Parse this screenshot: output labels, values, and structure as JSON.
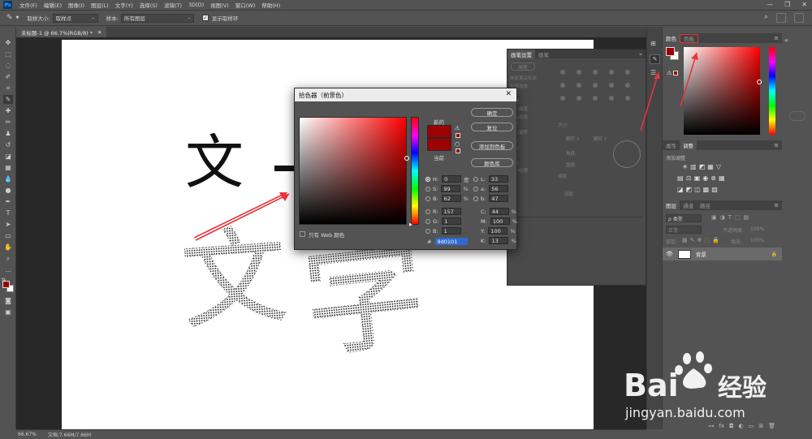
{
  "menubar": {
    "items": [
      "文件(F)",
      "编辑(E)",
      "图像(I)",
      "图层(L)",
      "文字(Y)",
      "选择(S)",
      "滤镜(T)",
      "3D(D)",
      "视图(V)",
      "窗口(W)",
      "帮助(H)"
    ],
    "app_logo": "Ps"
  },
  "options": {
    "sample_size_label": "取样大小:",
    "sample_size_value": "取样点",
    "sample_label": "样本:",
    "sample_value": "所有图层",
    "show_ring_label": "显示取样环"
  },
  "document": {
    "tab_title": "未标题-1 @ 66.7%(RGB/8) *",
    "zoom": "66.67%",
    "doc_info": "文档:7.66M/7.66M"
  },
  "color_picker": {
    "title": "拾色器（前景色）",
    "new_label": "新的",
    "current_label": "当前",
    "ok": "确定",
    "reset": "复位",
    "add_swatch": "添加到色板",
    "color_library": "颜色库",
    "web_only": "只有 Web 颜色",
    "hex_prefix": "#",
    "hex": "9d0101",
    "fields": {
      "H": {
        "label": "H:",
        "value": "0",
        "unit": "度"
      },
      "S": {
        "label": "S:",
        "value": "99",
        "unit": "%"
      },
      "B": {
        "label": "B:",
        "value": "62",
        "unit": "%"
      },
      "R": {
        "label": "R:",
        "value": "157",
        "unit": ""
      },
      "G": {
        "label": "G:",
        "value": "1",
        "unit": ""
      },
      "Bl": {
        "label": "B:",
        "value": "1",
        "unit": ""
      },
      "L": {
        "label": "L:",
        "value": "33",
        "unit": ""
      },
      "a": {
        "label": "a:",
        "value": "56",
        "unit": ""
      },
      "b": {
        "label": "b:",
        "value": "47",
        "unit": ""
      },
      "C": {
        "label": "C:",
        "value": "44",
        "unit": "%"
      },
      "M": {
        "label": "M:",
        "value": "100",
        "unit": "%"
      },
      "Y": {
        "label": "Y:",
        "value": "100",
        "unit": "%"
      },
      "K": {
        "label": "K:",
        "value": "13",
        "unit": "%"
      }
    },
    "new_color": "#9d0101",
    "current_color": "#9d0101"
  },
  "brush_settings": {
    "tabs": [
      "画笔设置",
      "画笔"
    ],
    "brush_button": "画笔",
    "items": [
      "画笔笔尖形状",
      "形状动态",
      "散布",
      "纹理",
      "双重画笔",
      "颜色动态",
      "传递",
      "画笔笔势",
      "杂色",
      "湿边",
      "建立",
      "平滑",
      "保护纹理"
    ],
    "size_label": "大小",
    "flip_x": "翻转 X",
    "flip_y": "翻转 Y",
    "angle_label": "角度:",
    "roundness_label": "圆度:",
    "hardness_label": "硬度",
    "spacing_label": "间距"
  },
  "color_panel": {
    "tabs": [
      "颜色",
      "色板"
    ],
    "fg": "#9d0101",
    "bg": "#ffffff"
  },
  "adjust_panel": {
    "tabs": [
      "属性",
      "调整"
    ],
    "add_label": "添加调整"
  },
  "layers_panel": {
    "tabs": [
      "图层",
      "通道",
      "路径"
    ],
    "kind_label": "ρ 类型",
    "mode": "正常",
    "opacity_label": "不透明度:",
    "opacity": "100%",
    "lock_label": "锁定:",
    "fill_label": "填充:",
    "fill": "100%",
    "layer_name": "背景"
  },
  "canvas_text": {
    "top_left": "文",
    "top_right": "字",
    "bottom_left": "文",
    "bottom_right": "字"
  },
  "watermark": {
    "brand": "Bai",
    "brand_suffix": "经验",
    "url": "jingyan.baidu.com"
  }
}
